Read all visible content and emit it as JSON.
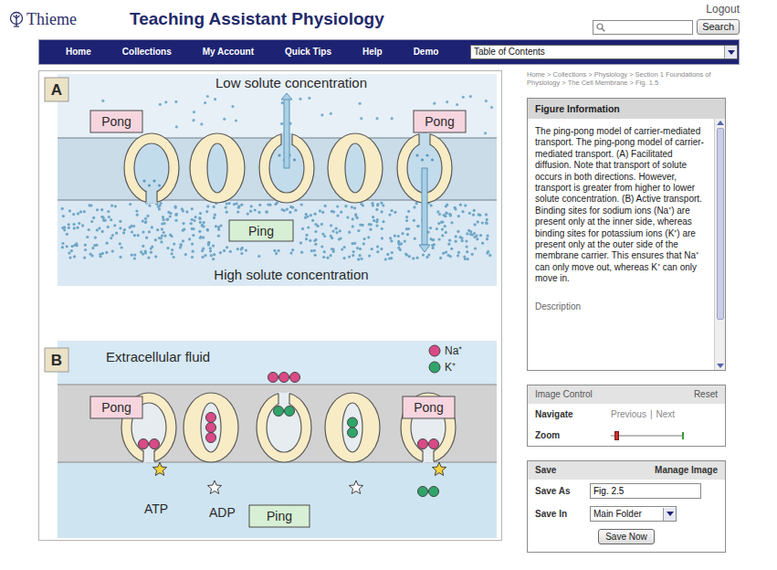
{
  "header": {
    "logo": "Thieme",
    "title": "Teaching Assistant Physiology",
    "logout": "Logout",
    "search_button": "Search"
  },
  "nav": {
    "items": [
      {
        "label": "Home"
      },
      {
        "label": "Collections"
      },
      {
        "label": "My Account"
      },
      {
        "label": "Quick Tips"
      },
      {
        "label": "Help"
      },
      {
        "label": "Demo"
      }
    ],
    "select": "Table of Contents"
  },
  "breadcrumb": "Home > Collections > Physiology > Section 1 Foundations of Physiology > The Cell Membrane > Fig. 1.5",
  "figure": {
    "panel_a": {
      "letter": "A",
      "top_text": "Low solute concentration",
      "bottom_text": "High solute concentration",
      "pong_left": "Pong",
      "pong_right": "Pong",
      "ping": "Ping",
      "carriers": [
        {
          "kind": "open-bottom",
          "arrow": "none"
        },
        {
          "kind": "closed",
          "arrow": "none"
        },
        {
          "kind": "open-top",
          "arrow": "up"
        },
        {
          "kind": "closed",
          "arrow": "none"
        },
        {
          "kind": "open-top",
          "arrow": "down"
        }
      ]
    },
    "panel_b": {
      "letter": "B",
      "top_text": "Extracellular fluid",
      "legend": [
        {
          "label": "Na⁺",
          "ion": "na",
          "color": "#d94a86"
        },
        {
          "label": "K⁺",
          "ion": "k",
          "color": "#2fa56a"
        }
      ],
      "pong_left": "Pong",
      "pong_right": "Pong",
      "ping": "Ping",
      "atp": "ATP",
      "adp": "ADP",
      "carriers": [
        {
          "kind": "open-bottom",
          "inside": [
            "na",
            "na"
          ],
          "outside": [],
          "star": "atp"
        },
        {
          "kind": "closed",
          "inside": [
            "na",
            "na",
            "na"
          ],
          "outside": [],
          "star": "adp"
        },
        {
          "kind": "open-top",
          "inside": [
            "k",
            "k"
          ],
          "outside": [
            "na",
            "na",
            "na"
          ],
          "star": "none"
        },
        {
          "kind": "closed",
          "inside": [
            "k",
            "k"
          ],
          "outside": [],
          "star": "adp"
        },
        {
          "kind": "open-bottom",
          "inside": [
            "na",
            "na"
          ],
          "outside": [
            "k",
            "k"
          ],
          "star": "atp"
        }
      ]
    }
  },
  "figure_info": {
    "title": "Figure Information",
    "text": "The ping-pong model of carrier-mediated transport. The ping-pong model of carrier-mediated transport. (A) Facilitated diffusion. Note that transport of solute occurs in both directions. However, transport is greater from higher to lower solute concentration. (B) Active transport. Binding sites for sodium ions (Na⁺) are present only at the inner side, whereas binding sites for potassium ions (K⁺) are present only at the outer side of the membrane carrier. This ensures that Na⁺ can only move out, whereas K⁺ can only move in.",
    "description": "Description"
  },
  "image_control": {
    "title": "Image Control",
    "reset": "Reset",
    "navigate": "Navigate",
    "previous": "Previous",
    "separator": "|",
    "next": "Next",
    "zoom": "Zoom",
    "zoom_level": 0.05
  },
  "save": {
    "title": "Save",
    "manage": "Manage Image",
    "save_as": "Save As",
    "save_as_value": "Fig. 2.5",
    "save_in": "Save In",
    "save_in_value": "Main Folder",
    "button": "Save Now"
  }
}
